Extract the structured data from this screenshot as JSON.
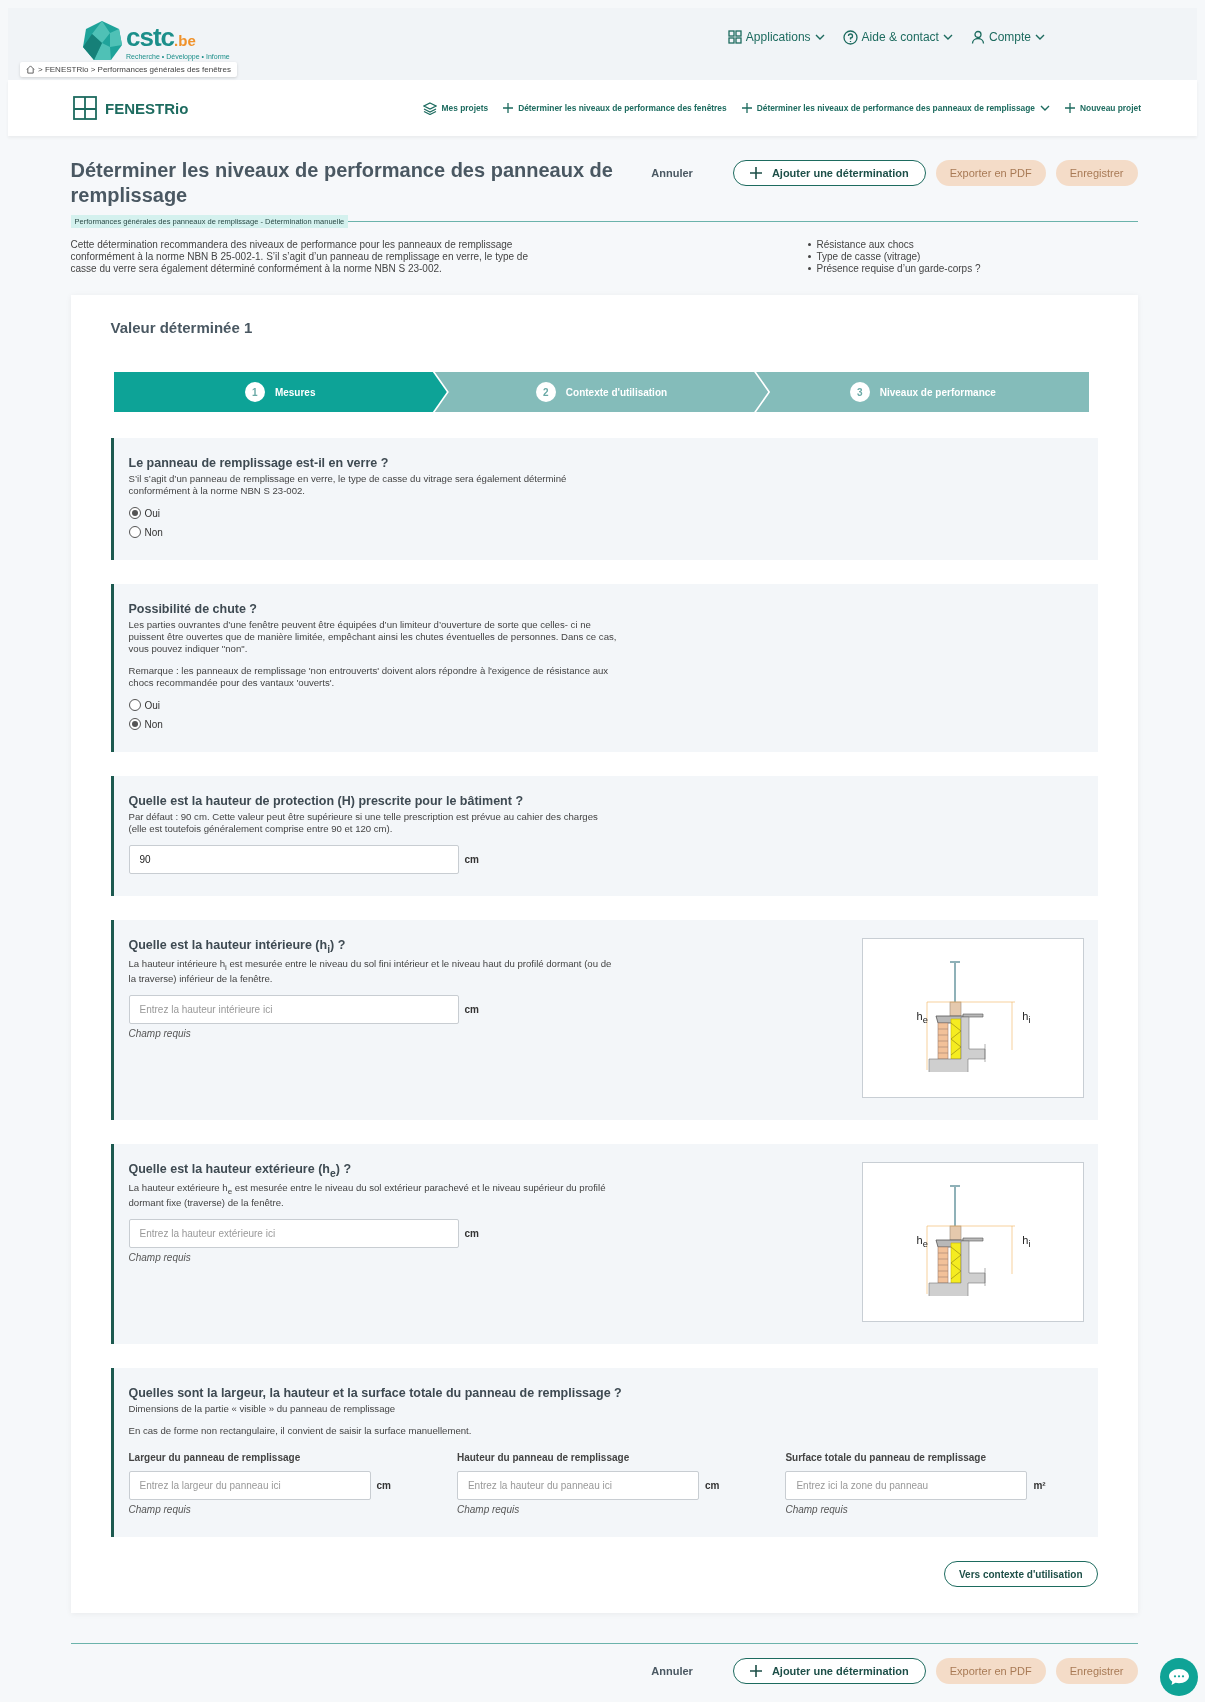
{
  "header": {
    "logo": {
      "name": "cstc",
      "suffix": ".be",
      "tagline": "Recherche • Développe • Informe"
    },
    "nav": [
      {
        "label": "Applications",
        "kind": "apps"
      },
      {
        "label": "Aide & contact",
        "kind": "help"
      },
      {
        "label": "Compte",
        "kind": "account"
      }
    ],
    "breadcrumb": "> FENESTRio > Performances générales des fenêtres"
  },
  "app_bar": {
    "title": "FENESTRio",
    "nav": [
      {
        "label": "Mes projets",
        "kind": "projects",
        "menu": false
      },
      {
        "label": "Déterminer les niveaux de performance des fenêtres",
        "kind": "add",
        "menu": false
      },
      {
        "label": "Déterminer les niveaux de performance des panneaux de remplissage",
        "kind": "add",
        "menu": true
      },
      {
        "label": "Nouveau projet",
        "kind": "add",
        "menu": false
      }
    ]
  },
  "page": {
    "title": "Déterminer les niveaux de performance des panneaux de remplissage",
    "subtitle": "Performances générales des panneaux de remplissage - Détermination manuelle",
    "intro": "Cette détermination recommandera des niveaux de performance pour les panneaux de remplissage conformément à la norme NBN B 25-002-1. S’il s’agit d’un panneau de remplissage en verre, le type de casse du verre sera également déterminé conformément à la norme NBN S 23-002.",
    "bullets": [
      "Résistance aux chocs",
      "Type de casse (vitrage)",
      "Présence requise d’un garde-corps ?"
    ]
  },
  "top_actions": [
    {
      "label": "Annuler",
      "kind": "link"
    },
    {
      "label": "Ajouter une détermination",
      "kind": "add"
    },
    {
      "label": "Exporter en PDF",
      "kind": "primary",
      "disabled": true
    },
    {
      "label": "Enregistrer",
      "kind": "primary",
      "disabled": true
    }
  ],
  "card": {
    "title": "Valeur déterminée 1",
    "steps": [
      {
        "number": "1",
        "label": "Mesures",
        "selected": true
      },
      {
        "number": "2",
        "label": "Contexte d'utilisation",
        "selected": false
      },
      {
        "number": "3",
        "label": "Niveaux de performance",
        "selected": false
      }
    ],
    "sections": [
      {
        "kind": "radio",
        "title": "Le panneau de remplissage est-il en verre ?",
        "description": [
          "S’il s’agit d’un panneau de remplissage en verre, le type de casse du vitrage sera également déterminé conformément à la norme NBN S 23-002."
        ],
        "options": [
          {
            "label": "Oui",
            "selected": true
          },
          {
            "label": "Non",
            "selected": false
          }
        ]
      },
      {
        "kind": "radio",
        "title": "Possibilité de chute ?",
        "description": [
          "Les parties ouvrantes d’une fenêtre peuvent être équipées d’un limiteur d’ouverture de sorte que celles- ci ne puissent être ouvertes que de manière limitée, empêchant ainsi les chutes éventuelles de personnes. Dans ce cas, vous pouvez indiquer \"non\".",
          "Remarque : les panneaux de remplissage 'non entrouverts' doivent alors répondre à l'exigence de résistance aux chocs recommandée pour des vantaux 'ouverts'."
        ],
        "options": [
          {
            "label": "Oui",
            "selected": false
          },
          {
            "label": "Non",
            "selected": true
          }
        ]
      },
      {
        "kind": "input",
        "title": "Quelle est la hauteur de protection (H) prescrite pour le bâtiment ?",
        "description": [
          "Par défaut : 90 cm. Cette valeur peut être supérieure si une telle prescription est prévue au cahier des charges (elle est toutefois généralement comprise entre 90 et 120 cm)."
        ],
        "field": {
          "value": "90",
          "unit": "cm"
        }
      },
      {
        "kind": "input",
        "title": "Quelle est la hauteur intérieure (h$_{i}$) ?",
        "description": [
          "La hauteur intérieure h$_{i}$ est mesurée entre le niveau du sol fini intérieur et le niveau haut du profilé dormant (ou de la traverse) inférieur de la fenêtre."
        ],
        "field": {
          "placeholder": "Entrez la hauteur intérieure ici",
          "unit": "cm",
          "note": "Champ requis"
        },
        "figure": {
          "labels": [
            "h$_{e}$",
            "h$_{i}$"
          ]
        }
      },
      {
        "kind": "input",
        "title": "Quelle est la hauteur extérieure (h$_{e}$) ?",
        "description": [
          "La hauteur extérieure h$_{e}$ est mesurée entre le niveau du sol extérieur parachevé et le niveau supérieur du profilé dormant fixe (traverse) de la fenêtre."
        ],
        "field": {
          "placeholder": "Entrez la hauteur extérieure ici",
          "unit": "cm",
          "note": "Champ requis"
        },
        "figure": {
          "labels": [
            "h$_{e}$",
            "h$_{i}$"
          ]
        }
      },
      {
        "kind": "dims",
        "title": "Quelles sont la largeur, la hauteur et la surface totale du panneau de remplissage ?",
        "description": [
          "Dimensions de la partie « visible » du panneau de remplissage",
          "En cas de forme non rectangulaire, il convient de saisir la surface manuellement."
        ],
        "fields": [
          {
            "label": "Largeur du panneau de remplissage",
            "placeholder": "Entrez la largeur du panneau ici",
            "unit": "cm",
            "note": "Champ requis"
          },
          {
            "label": "Hauteur du panneau de remplissage",
            "placeholder": "Entrez la hauteur du panneau ici",
            "unit": "cm",
            "note": "Champ requis"
          },
          {
            "label": "Surface totale du panneau de remplissage",
            "placeholder": "Entrez ici la zone du panneau",
            "unit": "m²",
            "note": "Champ requis"
          }
        ]
      }
    ],
    "next": "Vers contexte d'utilisation"
  },
  "bottom_actions": [
    {
      "label": "Annuler",
      "kind": "link"
    },
    {
      "label": "Ajouter une détermination",
      "kind": "add"
    },
    {
      "label": "Exporter en PDF",
      "kind": "primary",
      "disabled": true
    },
    {
      "label": "Enregistrer",
      "kind": "primary",
      "disabled": true
    }
  ]
}
